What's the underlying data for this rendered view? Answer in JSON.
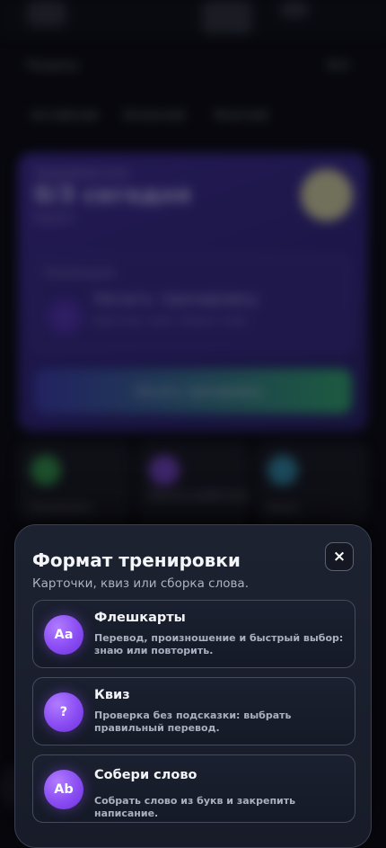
{
  "background": {
    "section_label": "Разделы",
    "section_action": "Всё",
    "languages": [
      "Английский",
      "Испанский",
      "Японский"
    ],
    "goal_label": "Ежедневная цель",
    "progress_text": "0/3 сегодня",
    "progress_sub": "Неделя",
    "recommended_label": "Рекомендуем",
    "start_title": "Начать тренировку",
    "start_sub": "Карточки, квиз, сборка слова",
    "start_button": "Начать тренировку",
    "tiles": [
      "Тренировка",
      "Повтор ошибочных",
      "Уроки"
    ]
  },
  "sheet": {
    "title": "Формат тренировки",
    "subtitle": "Карточки, квиз или сборка слова.",
    "close_glyph": "×",
    "options": [
      {
        "icon_text": "Aa",
        "title": "Флешкарты",
        "description": "Перевод, произношение и быстрый выбор: знаю или повторить."
      },
      {
        "icon_text": "?",
        "title": "Квиз",
        "description": "Проверка без подсказки: выбрать правильный перевод."
      },
      {
        "icon_text": "Ab",
        "title": "Собери слово",
        "description": "Собрать слово из букв и закрепить написание."
      }
    ]
  },
  "colors": {
    "accent": "#8a4cf3",
    "sheet_bg": "#1b2030",
    "page_bg": "#07070d"
  }
}
